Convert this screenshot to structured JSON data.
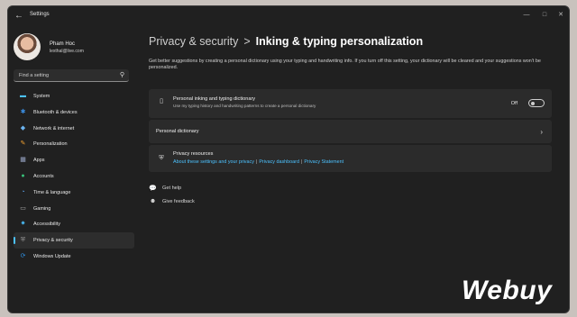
{
  "window": {
    "title": "Settings",
    "back_icon": "back-arrow-icon"
  },
  "profile": {
    "name": "Pham Hoc",
    "email": "lexthal@live.com"
  },
  "search": {
    "placeholder": "Find a setting",
    "icon": "search-icon"
  },
  "sidebar": {
    "items": [
      {
        "label": "System",
        "icon": "monitor-icon",
        "color": "#4cc2ff",
        "active": false
      },
      {
        "label": "Bluetooth & devices",
        "icon": "bluetooth-icon",
        "color": "#3a8de0",
        "active": false
      },
      {
        "label": "Network & internet",
        "icon": "wifi-icon",
        "color": "#6cb4f0",
        "active": false
      },
      {
        "label": "Personalization",
        "icon": "brush-icon",
        "color": "#f0a030",
        "active": false
      },
      {
        "label": "Apps",
        "icon": "apps-icon",
        "color": "#9aa7c7",
        "active": false
      },
      {
        "label": "Accounts",
        "icon": "person-icon",
        "color": "#39c07a",
        "active": false
      },
      {
        "label": "Time & language",
        "icon": "globe-clock-icon",
        "color": "#5aa0e6",
        "active": false
      },
      {
        "label": "Gaming",
        "icon": "gamepad-icon",
        "color": "#aaaaaa",
        "active": false
      },
      {
        "label": "Accessibility",
        "icon": "accessibility-icon",
        "color": "#4cc2ff",
        "active": false
      },
      {
        "label": "Privacy & security",
        "icon": "shield-icon",
        "color": "#9a9a9a",
        "active": true
      },
      {
        "label": "Windows Update",
        "icon": "update-icon",
        "color": "#2f8fe0",
        "active": false
      }
    ]
  },
  "header": {
    "parent": "Privacy & security",
    "separator": ">",
    "current": "Inking & typing personalization"
  },
  "description": "Get better suggestions by creating a personal dictionary using your typing and handwriting info. If you turn off this setting, your dictionary will be cleared and your suggestions won't be personalized.",
  "cards": {
    "inking": {
      "title": "Personal inking and typing dictionary",
      "subtitle": "Use my typing history and handwriting patterns to create a personal dictionary",
      "toggle_label": "Off",
      "toggle_on": false,
      "icon": "dictionary-icon"
    },
    "personal_dictionary": {
      "title": "Personal dictionary",
      "chevron_icon": "chevron-right-icon"
    },
    "privacy": {
      "title": "Privacy resources",
      "icon": "shield-icon",
      "links": [
        "About these settings and your privacy",
        "Privacy dashboard",
        "Privacy Statement"
      ],
      "link_separator": "|"
    }
  },
  "help": [
    {
      "label": "Get help",
      "icon": "help-icon"
    },
    {
      "label": "Give feedback",
      "icon": "feedback-icon"
    }
  ],
  "watermark": "Webuy",
  "colors": {
    "accent": "#4cc2ff",
    "background": "#202020",
    "card": "#2b2b2b"
  }
}
